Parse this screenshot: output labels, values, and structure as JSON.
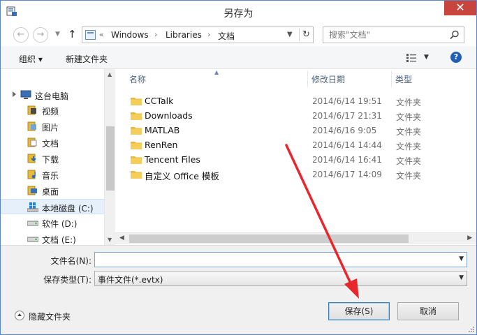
{
  "window": {
    "title": "另存为",
    "close_glyph": "✕"
  },
  "nav": {
    "back_glyph": "←",
    "forward_glyph": "→",
    "up_glyph": "↑"
  },
  "address": {
    "overflow": "«",
    "crumbs": [
      "Windows",
      "Libraries",
      "文档"
    ],
    "separator": "›",
    "refresh_glyph": "↻"
  },
  "search": {
    "placeholder": "搜索\"文档\""
  },
  "toolbar": {
    "organize_label": "组织 ▾",
    "new_folder_label": "新建文件夹",
    "help_glyph": "?"
  },
  "sidebar": {
    "items": [
      {
        "label": "这台电脑",
        "icon": "computer-icon"
      },
      {
        "label": "视频",
        "icon": "video-library-icon"
      },
      {
        "label": "图片",
        "icon": "pictures-library-icon"
      },
      {
        "label": "文档",
        "icon": "documents-library-icon"
      },
      {
        "label": "下载",
        "icon": "downloads-icon"
      },
      {
        "label": "音乐",
        "icon": "music-library-icon"
      },
      {
        "label": "桌面",
        "icon": "desktop-icon"
      },
      {
        "label": "本地磁盘 (C:)",
        "icon": "windows-drive-icon"
      },
      {
        "label": "软件 (D:)",
        "icon": "drive-icon"
      },
      {
        "label": "文档 (E:)",
        "icon": "drive-icon"
      }
    ]
  },
  "files": {
    "columns": {
      "name": "名称",
      "date": "修改日期",
      "type": "类型"
    },
    "rows": [
      {
        "name": "CCTalk",
        "date": "2014/6/14 19:51",
        "type": "文件夹"
      },
      {
        "name": "Downloads",
        "date": "2014/6/17 21:31",
        "type": "文件夹"
      },
      {
        "name": "MATLAB",
        "date": "2014/6/16 9:05",
        "type": "文件夹"
      },
      {
        "name": "RenRen",
        "date": "2014/6/14 14:44",
        "type": "文件夹"
      },
      {
        "name": "Tencent Files",
        "date": "2014/6/14 16:41",
        "type": "文件夹"
      },
      {
        "name": "自定义 Office 模板",
        "date": "2014/6/17 14:09",
        "type": "文件夹"
      }
    ]
  },
  "save_form": {
    "filename_label": "文件名(N):",
    "filename_value": "",
    "filetype_label": "保存类型(T):",
    "filetype_value": "事件文件(*.evtx)",
    "hide_folders_label": "隐藏文件夹",
    "save_label": "保存(S)",
    "cancel_label": "取消"
  },
  "colors": {
    "annotation_arrow": "#e8262b",
    "folder": "#e8b93a",
    "close_button": "#c7453d"
  }
}
